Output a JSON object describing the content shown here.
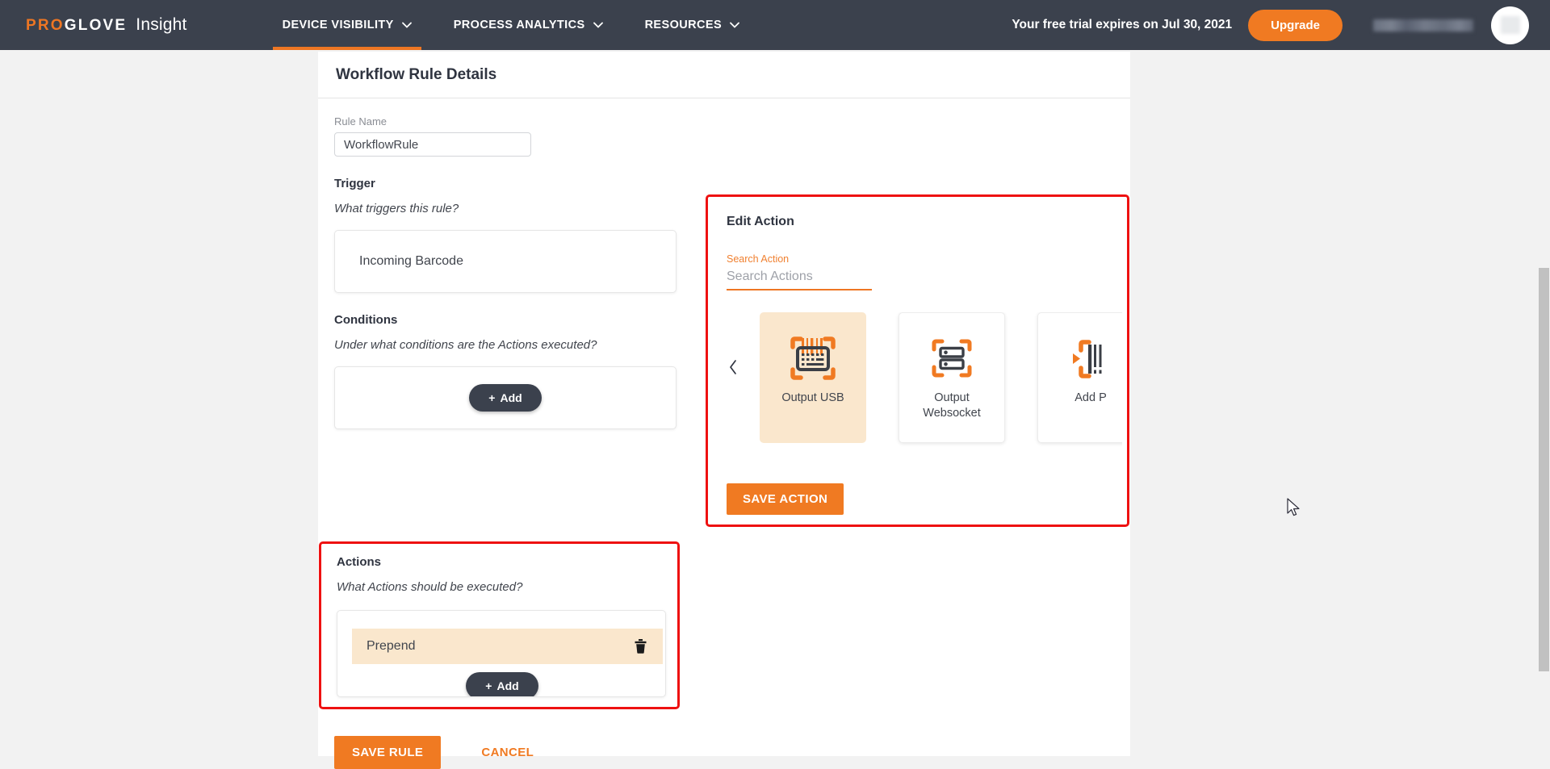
{
  "topnav": {
    "brand": {
      "pro": "PRO",
      "glove": "GLOVE",
      "product": "Insight"
    },
    "items": [
      {
        "label": "DEVICE VISIBILITY",
        "caret": "chevron-down-icon",
        "active": true
      },
      {
        "label": "PROCESS ANALYTICS",
        "caret": "chevron-down-icon",
        "active": false
      },
      {
        "label": "RESOURCES",
        "caret": "chevron-down-icon",
        "active": false
      }
    ],
    "trial_text": "Your free trial expires on Jul 30, 2021",
    "upgrade_label": "Upgrade",
    "account_name_redacted": "",
    "avatar": "user-avatar"
  },
  "page": {
    "card_title": "Workflow Rule Details",
    "rule_name": {
      "label": "Rule Name",
      "value": "WorkflowRule",
      "placeholder": ""
    },
    "trigger": {
      "title": "Trigger",
      "subtitle": "What triggers this rule?",
      "item": "Incoming Barcode"
    },
    "conditions": {
      "title": "Conditions",
      "subtitle": "Under what conditions are the Actions executed?",
      "add_label": "Add",
      "add_plus": "+"
    },
    "actions": {
      "title": "Actions",
      "subtitle": "What Actions should be executed?",
      "rows": [
        {
          "label": "Prepend",
          "delete_icon": "trash-icon",
          "selected": true
        }
      ],
      "add_label": "Add",
      "add_plus": "+",
      "highlight_border_color": "#ee1111"
    },
    "edit_action": {
      "title": "Edit Action",
      "search_label": "Search Action",
      "search_value": "",
      "search_placeholder": "Search Actions",
      "prev_arrow": "chevron-left-icon",
      "next_arrow": "chevron-right-icon",
      "cards": [
        {
          "label": "Output USB",
          "icon": "barcode-keyboard-icon",
          "selected": true
        },
        {
          "label": "Output Websocket",
          "icon": "server-scan-icon",
          "selected": false
        },
        {
          "label": "Add P",
          "icon": "add-prefix-barcode-icon",
          "selected": false
        }
      ],
      "save_label": "SAVE ACTION",
      "highlight_border_color": "#ee1111"
    },
    "footer": {
      "save_rule_label": "SAVE RULE",
      "cancel_label": "CANCEL"
    }
  },
  "colors": {
    "brand_orange": "#ee7623",
    "button_orange": "#f07a22",
    "nav_dark": "#3b414d",
    "highlight_bg": "#fae7cd",
    "annotation_red": "#ee1111"
  }
}
